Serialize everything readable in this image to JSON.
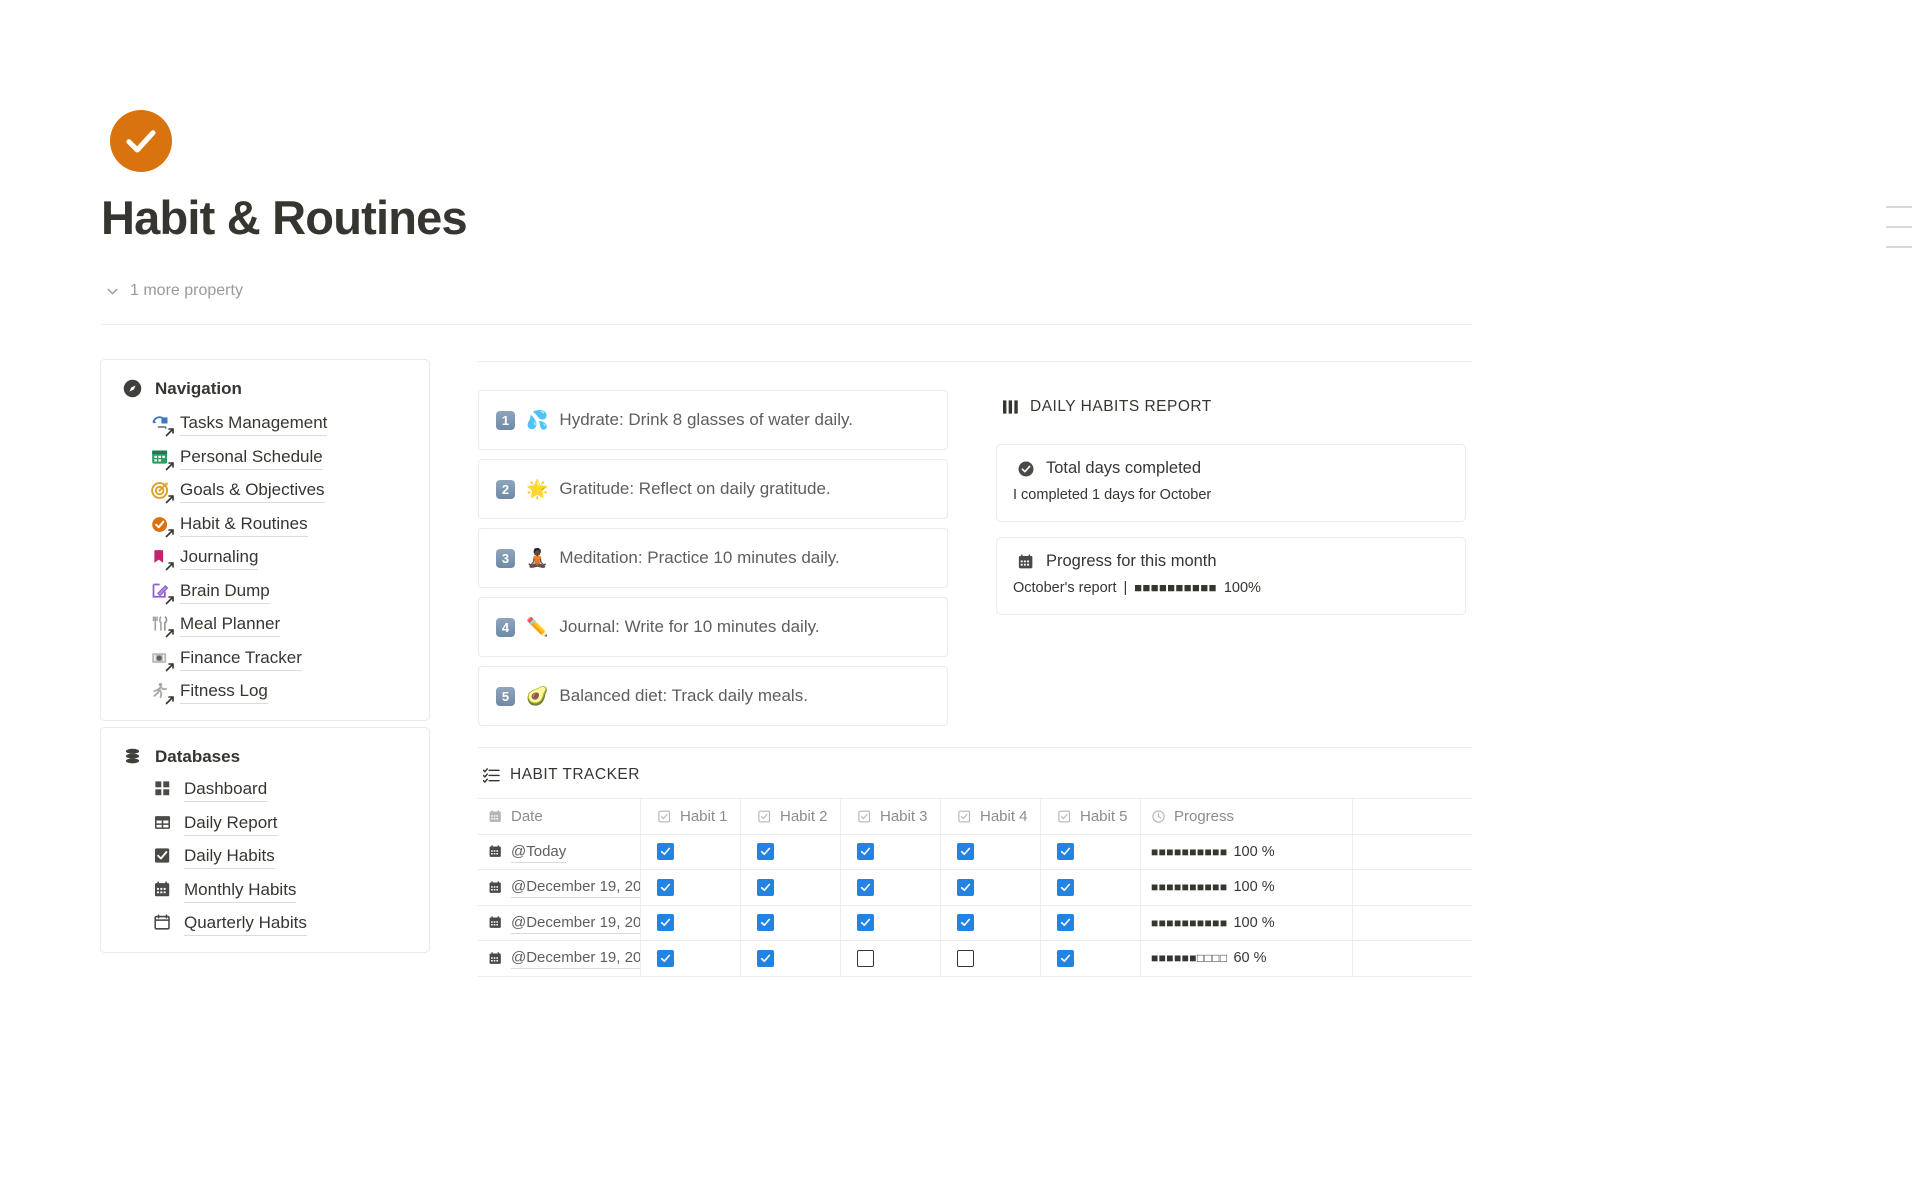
{
  "header": {
    "icon": "orange-check-circle-icon",
    "title": "Habit & Routines",
    "more_property": "1 more property"
  },
  "sidebar": {
    "navigation": {
      "title": "Navigation",
      "icon": "compass-icon",
      "items": [
        {
          "label": "Tasks Management",
          "icon": "recycle-task-icon"
        },
        {
          "label": "Personal Schedule",
          "icon": "calendar-green-icon"
        },
        {
          "label": "Goals & Objectives",
          "icon": "target-dart-icon"
        },
        {
          "label": "Habit & Routines",
          "icon": "orange-check-circle-icon"
        },
        {
          "label": "Journaling",
          "icon": "bookmark-icon"
        },
        {
          "label": "Brain Dump",
          "icon": "pencil-square-icon"
        },
        {
          "label": "Meal Planner",
          "icon": "cutlery-icon"
        },
        {
          "label": "Finance Tracker",
          "icon": "money-note-icon"
        },
        {
          "label": "Fitness Log",
          "icon": "runner-icon"
        }
      ]
    },
    "databases": {
      "title": "Databases",
      "icon": "database-icon",
      "items": [
        {
          "label": "Dashboard",
          "icon": "grid-squares-icon"
        },
        {
          "label": "Daily Report",
          "icon": "table-icon"
        },
        {
          "label": "Daily Habits",
          "icon": "checkbox-checked-icon"
        },
        {
          "label": "Monthly Habits",
          "icon": "calendar-icon"
        },
        {
          "label": "Quarterly Habits",
          "icon": "calendar-outline-icon"
        }
      ]
    }
  },
  "habits": [
    {
      "number": "1",
      "emoji": "💦",
      "text": "Hydrate: Drink 8 glasses of water daily."
    },
    {
      "number": "2",
      "emoji": "🌟",
      "text": "Gratitude: Reflect on daily gratitude."
    },
    {
      "number": "3",
      "emoji": "🧘🏿",
      "text": "Meditation: Practice 10 minutes daily."
    },
    {
      "number": "4",
      "emoji": "✏️",
      "text": "Journal: Write for 10 minutes daily."
    },
    {
      "number": "5",
      "emoji": "🥑",
      "text": "Balanced diet: Track daily meals."
    }
  ],
  "report": {
    "section_title": "DAILY HABITS REPORT",
    "section_icon": "bar-chart-icon",
    "total_days": {
      "icon": "check-circle-icon",
      "title": "Total days completed",
      "subtitle": "I completed 1 days for October"
    },
    "progress_month": {
      "icon": "calendar-icon",
      "title": "Progress for this month",
      "label": "October's report",
      "separator": "|",
      "bar": "■■■■■■■■■■",
      "percent": "100%"
    }
  },
  "tracker": {
    "section_title": "HABIT TRACKER",
    "section_icon": "checklist-icon",
    "columns": [
      {
        "label": "Date",
        "icon": "calendar-icon"
      },
      {
        "label": "Habit 1",
        "icon": "checkbox-icon"
      },
      {
        "label": "Habit 2",
        "icon": "checkbox-icon"
      },
      {
        "label": "Habit 3",
        "icon": "checkbox-icon"
      },
      {
        "label": "Habit 4",
        "icon": "checkbox-icon"
      },
      {
        "label": "Habit 5",
        "icon": "checkbox-icon"
      },
      {
        "label": "Progress",
        "icon": "clock-icon"
      }
    ],
    "rows": [
      {
        "date": "@Today",
        "habits": [
          true,
          true,
          true,
          true,
          true
        ],
        "bar": "■■■■■■■■■■",
        "percent": "100 %"
      },
      {
        "date": "@December 19, 20",
        "habits": [
          true,
          true,
          true,
          true,
          true
        ],
        "bar": "■■■■■■■■■■",
        "percent": "100 %"
      },
      {
        "date": "@December 19, 20",
        "habits": [
          true,
          true,
          true,
          true,
          true
        ],
        "bar": "■■■■■■■■■■",
        "percent": "100 %"
      },
      {
        "date": "@December 19, 20",
        "habits": [
          true,
          true,
          false,
          false,
          true
        ],
        "bar": "■■■■■■□□□□",
        "percent": "60 %"
      }
    ]
  },
  "colors": {
    "accent_orange": "#d9730d",
    "checkbox_blue": "#2383e2",
    "text": "#37352f",
    "muted": "#9b9a97"
  }
}
